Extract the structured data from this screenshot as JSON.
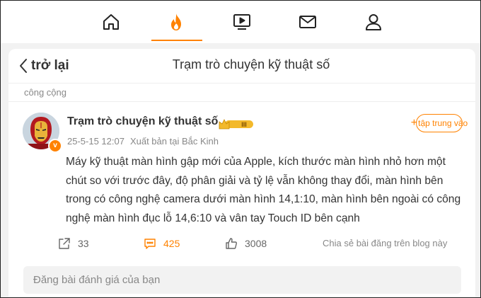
{
  "nav": {
    "items": [
      {
        "icon": "home-icon",
        "active": false
      },
      {
        "icon": "hot-icon",
        "active": true
      },
      {
        "icon": "video-icon",
        "active": false
      },
      {
        "icon": "mail-icon",
        "active": false
      },
      {
        "icon": "profile-icon",
        "active": false
      }
    ],
    "accent_color": "#ff8200"
  },
  "header": {
    "back_label": "trở lại",
    "title": "Trạm trò chuyện kỹ thuật số"
  },
  "section_label": "công cộng",
  "post": {
    "author": "Trạm trò chuyện kỹ thuật số",
    "badge": "III",
    "verified_mark": "v",
    "date": "25-5-15 12:07",
    "source": "Xuất bản tại Bắc Kinh",
    "follow_label": "tập trung vào",
    "body": "Máy kỹ thuật màn hình gập mới của Apple, kích thước màn hình nhỏ hơn một chút so với trước đây, độ phân giải và tỷ lệ vẫn không thay đổi, màn hình bên trong có công nghệ camera dưới màn hình 14,1:10, màn hình bên ngoài có công nghệ màn hình đục lỗ 14,6:10 và vân tay Touch ID bên cạnh",
    "reposts": "33",
    "comments": "425",
    "likes": "3008",
    "share_label": "Chia sẻ bài đăng trên blog này"
  },
  "comment_input": {
    "placeholder": "Đăng bài đánh giá của bạn",
    "value": ""
  }
}
